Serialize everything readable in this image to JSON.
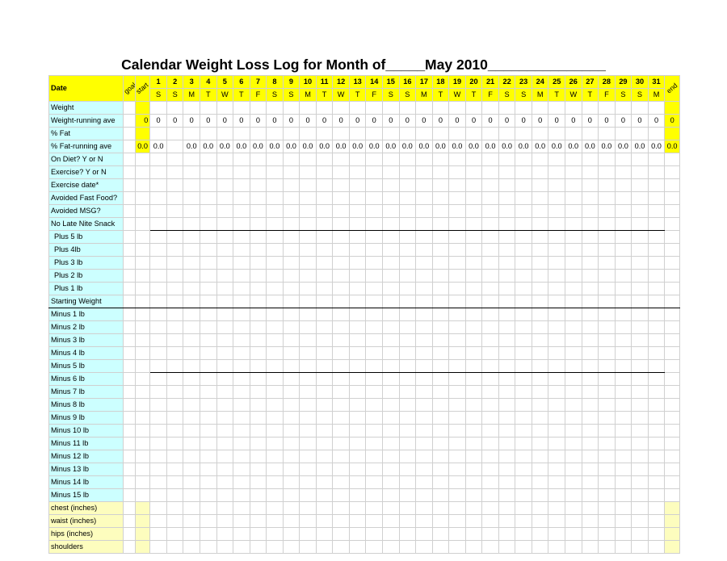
{
  "title": "Calendar Weight Loss Log for Month of_____May 2010_______________",
  "header": {
    "date_label": "Date",
    "goal_label": "goal",
    "start_label": "start",
    "end_label": "end",
    "days": [
      "1",
      "2",
      "3",
      "4",
      "5",
      "6",
      "7",
      "8",
      "9",
      "10",
      "11",
      "12",
      "13",
      "14",
      "15",
      "16",
      "17",
      "18",
      "19",
      "20",
      "21",
      "22",
      "23",
      "24",
      "25",
      "26",
      "27",
      "28",
      "29",
      "30",
      "31"
    ],
    "weekdays": [
      "S",
      "S",
      "M",
      "T",
      "W",
      "T",
      "F",
      "S",
      "S",
      "M",
      "T",
      "W",
      "T",
      "F",
      "S",
      "S",
      "M",
      "T",
      "W",
      "T",
      "F",
      "S",
      "S",
      "M",
      "T",
      "W",
      "T",
      "F",
      "S",
      "S",
      "M"
    ]
  },
  "rows": {
    "weight": {
      "label": "Weight"
    },
    "weight_run": {
      "label": "Weight-running ave",
      "start": "0",
      "days": [
        "0",
        "0",
        "0",
        "0",
        "0",
        "0",
        "0",
        "0",
        "0",
        "0",
        "0",
        "0",
        "0",
        "0",
        "0",
        "0",
        "0",
        "0",
        "0",
        "0",
        "0",
        "0",
        "0",
        "0",
        "0",
        "0",
        "0",
        "0",
        "0",
        "0",
        "0"
      ],
      "end": "0"
    },
    "pct_fat": {
      "label": "% Fat"
    },
    "pct_fat_run": {
      "label": "% Fat-running ave",
      "start": "0.0",
      "days": [
        "0.0",
        "",
        "0.0",
        "0.0",
        "0.0",
        "0.0",
        "0.0",
        "0.0",
        "0.0",
        "0.0",
        "0.0",
        "0.0",
        "0.0",
        "0.0",
        "0.0",
        "0.0",
        "0.0",
        "0.0",
        "0.0",
        "0.0",
        "0.0",
        "0.0",
        "0.0",
        "0.0",
        "0.0",
        "0.0",
        "0.0",
        "0.0",
        "0.0",
        "0.0",
        "0.0"
      ],
      "end": "0.0"
    },
    "on_diet": {
      "label": "On Diet? Y or N"
    },
    "exercise": {
      "label": "Exercise? Y or N"
    },
    "exercise_date": {
      "label": "Exercise date*"
    },
    "fastfood": {
      "label": "Avoided Fast Food?"
    },
    "msg": {
      "label": "Avoided MSG?"
    },
    "no_late": {
      "label": "No Late Nite Snack"
    },
    "p5": {
      "label": "Plus 5 lb"
    },
    "p4": {
      "label": "Plus 4lb"
    },
    "p3": {
      "label": "Plus 3 lb"
    },
    "p2": {
      "label": "Plus 2 lb"
    },
    "p1": {
      "label": "Plus 1 lb"
    },
    "startw": {
      "label": "Starting Weight"
    },
    "m1": {
      "label": "Minus 1 lb"
    },
    "m2": {
      "label": "Minus 2 lb"
    },
    "m3": {
      "label": "Minus 3 lb"
    },
    "m4": {
      "label": "Minus 4 lb"
    },
    "m5": {
      "label": "Minus 5 lb"
    },
    "m6": {
      "label": "Minus 6 lb"
    },
    "m7": {
      "label": "Minus 7 lb"
    },
    "m8": {
      "label": "Minus 8 lb"
    },
    "m9": {
      "label": "Minus 9 lb"
    },
    "m10": {
      "label": "Minus 10 lb"
    },
    "m11": {
      "label": "Minus 11 lb"
    },
    "m12": {
      "label": "Minus 12 lb"
    },
    "m13": {
      "label": "Minus 13 lb"
    },
    "m14": {
      "label": "Minus 14 lb"
    },
    "m15": {
      "label": "Minus 15 lb"
    },
    "chest": {
      "label": "chest (inches)"
    },
    "waist": {
      "label": "waist (inches)"
    },
    "hips": {
      "label": "hips (inches)"
    },
    "shoulders": {
      "label": "shoulders"
    }
  }
}
